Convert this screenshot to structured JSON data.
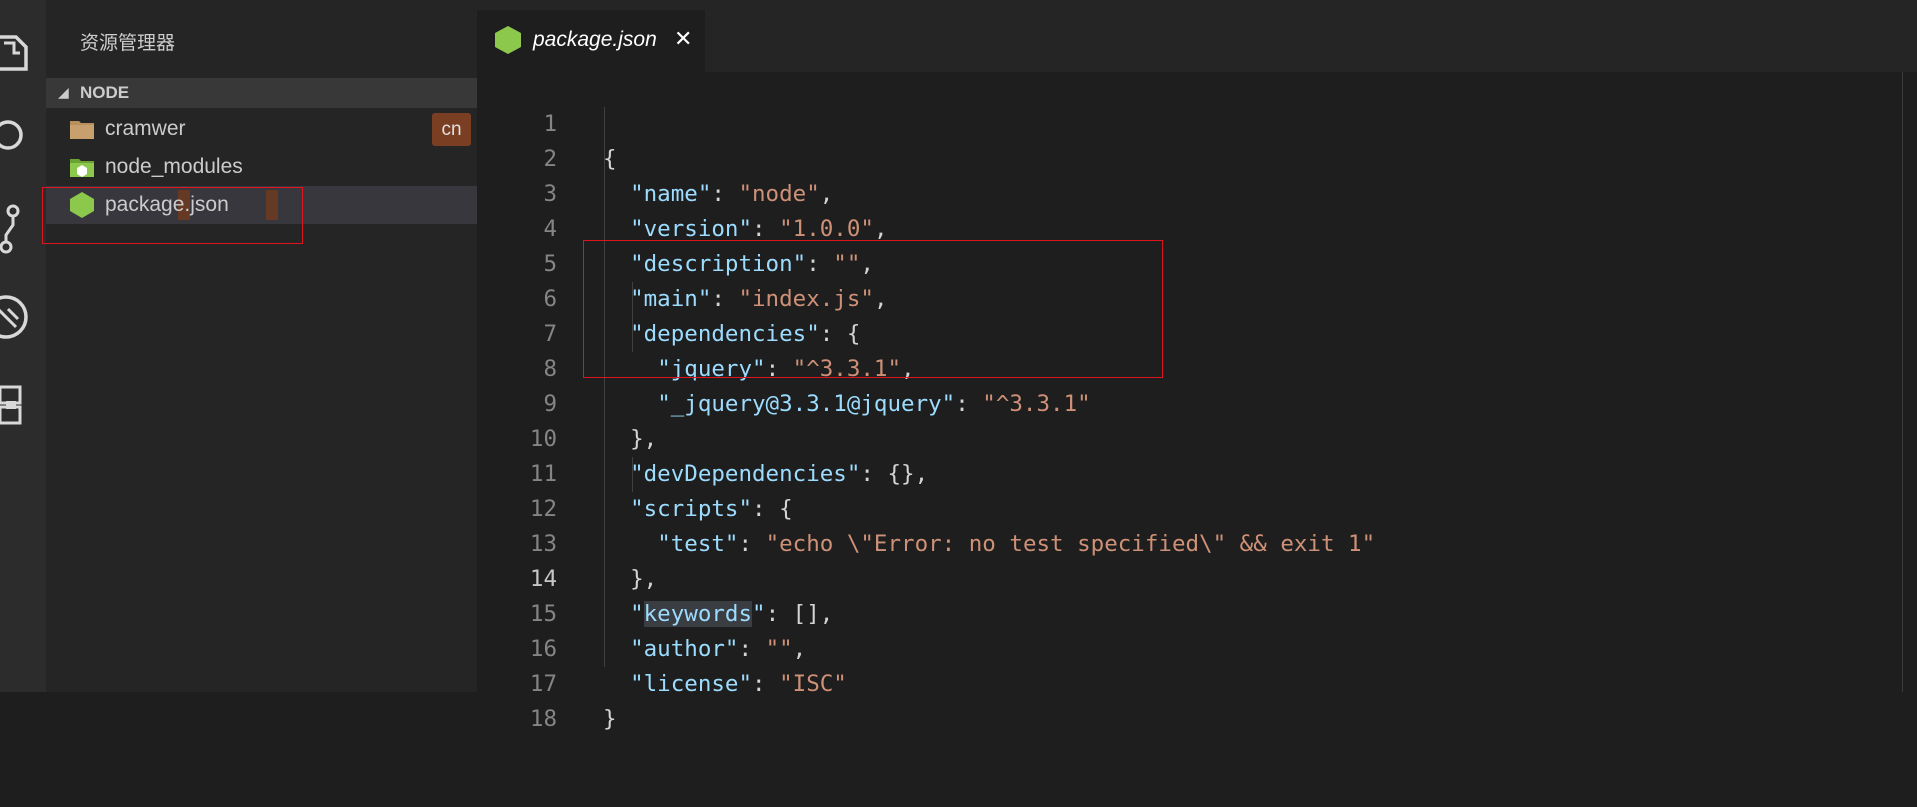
{
  "explorer": {
    "title": "资源管理器",
    "section": "NODE",
    "items": [
      {
        "name": "cramwer",
        "badge": "cn"
      },
      {
        "name": "node_modules"
      },
      {
        "name": "package.json"
      }
    ]
  },
  "tab": {
    "title": "package.json",
    "close": "✕"
  },
  "editor": {
    "lines": [
      {
        "n": "1",
        "text": "{"
      },
      {
        "n": "2",
        "text": "  \"name\": \"node\","
      },
      {
        "n": "3",
        "text": "  \"version\": \"1.0.0\","
      },
      {
        "n": "4",
        "text": "  \"description\": \"\","
      },
      {
        "n": "5",
        "text": "  \"main\": \"index.js\","
      },
      {
        "n": "6",
        "text": "  \"dependencies\": {"
      },
      {
        "n": "7",
        "text": "    \"jquery\": \"^3.3.1\","
      },
      {
        "n": "8",
        "text": "    \"_jquery@3.3.1@jquery\": \"^3.3.1\""
      },
      {
        "n": "9",
        "text": "  },"
      },
      {
        "n": "10",
        "text": "  \"devDependencies\": {},"
      },
      {
        "n": "11",
        "text": "  \"scripts\": {"
      },
      {
        "n": "12",
        "text": "    \"test\": \"echo \\\"Error: no test specified\\\" && exit 1\""
      },
      {
        "n": "13",
        "text": "  },"
      },
      {
        "n": "14",
        "text": "  \"keywords\": [],"
      },
      {
        "n": "15",
        "text": "  \"author\": \"\","
      },
      {
        "n": "16",
        "text": "  \"license\": \"ISC\""
      },
      {
        "n": "17",
        "text": "}"
      },
      {
        "n": "18",
        "text": ""
      }
    ],
    "active_line": "14"
  },
  "colors": {
    "key": "#9cdcfe",
    "string": "#ce9178",
    "punctuation": "#d4d4d4",
    "node_green": "#8cc84b",
    "highlight_red": "#e0141f"
  },
  "icons": [
    "files-icon",
    "search-icon",
    "git-icon",
    "debug-icon",
    "extensions-icon",
    "folder-icon",
    "node-folder-icon",
    "nodejs-hex-icon",
    "close-icon"
  ]
}
